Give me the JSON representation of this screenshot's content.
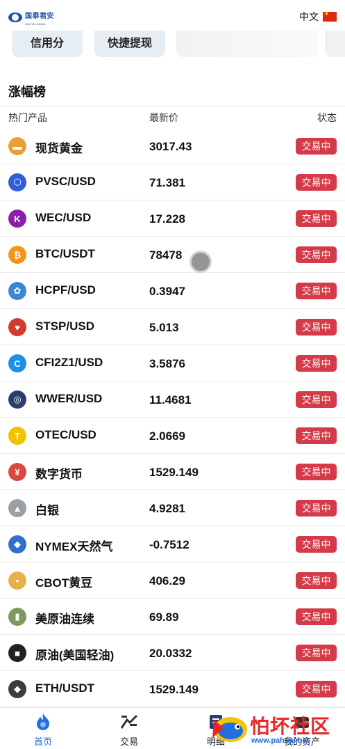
{
  "header": {
    "logo_text": "国泰君安",
    "logo_sub": "GUOTAI JUNAN",
    "language": "中文"
  },
  "cards": {
    "card1_label": "信用分",
    "card2_label": "快捷提现"
  },
  "section": {
    "title": "涨幅榜"
  },
  "columns": {
    "product": "热门产品",
    "price": "最新价",
    "status": "状态"
  },
  "rows": [
    {
      "name": "现货黄金",
      "price": "3017.43",
      "status": "交易中",
      "icon": "gold-ingot-icon",
      "color": "#e8a13a"
    },
    {
      "name": "PVSC/USD",
      "price": "71.381",
      "status": "交易中",
      "icon": "hexagon-icon",
      "color": "#2f5fd6"
    },
    {
      "name": "WEC/USD",
      "price": "17.228",
      "status": "交易中",
      "icon": "k-letter-icon",
      "color": "#8a1fa8"
    },
    {
      "name": "BTC/USDT",
      "price": "78478",
      "status": "交易中",
      "icon": "bitcoin-icon",
      "color": "#f7931a"
    },
    {
      "name": "HCPF/USD",
      "price": "0.3947",
      "status": "交易中",
      "icon": "flower-badge-icon",
      "color": "#3b87d6"
    },
    {
      "name": "STSP/USD",
      "price": "5.013",
      "status": "交易中",
      "icon": "heart-coin-icon",
      "color": "#d23b2c"
    },
    {
      "name": "CFI2Z1/USD",
      "price": "3.5876",
      "status": "交易中",
      "icon": "c-coin-icon",
      "color": "#1f8fe8"
    },
    {
      "name": "WWER/USD",
      "price": "11.4681",
      "status": "交易中",
      "icon": "ring-coin-icon",
      "color": "#2c3e6b"
    },
    {
      "name": "OTEC/USD",
      "price": "2.0669",
      "status": "交易中",
      "icon": "t-letter-icon",
      "color": "#f2c200"
    },
    {
      "name": "数字货币",
      "price": "1529.149",
      "status": "交易中",
      "icon": "yen-coin-icon",
      "color": "#d9473e"
    },
    {
      "name": "白银",
      "price": "4.9281",
      "status": "交易中",
      "icon": "silver-bars-icon",
      "color": "#9aa0a6"
    },
    {
      "name": "NYMEX天然气",
      "price": "-0.7512",
      "status": "交易中",
      "icon": "flame-icon",
      "color": "#2f6fc9"
    },
    {
      "name": "CBOT黄豆",
      "price": "406.29",
      "status": "交易中",
      "icon": "soybean-icon",
      "color": "#e8b04a"
    },
    {
      "name": "美原油连续",
      "price": "69.89",
      "status": "交易中",
      "icon": "oil-barrel-icon",
      "color": "#7d9a5c"
    },
    {
      "name": "原油(美国轻油)",
      "price": "20.0332",
      "status": "交易中",
      "icon": "oil-drum-icon",
      "color": "#222222"
    },
    {
      "name": "ETH/USDT",
      "price": "1529.149",
      "status": "交易中",
      "icon": "ethereum-icon",
      "color": "#3c3c3d"
    }
  ],
  "tabbar": {
    "home": "首页",
    "trade": "交易",
    "detail": "明细",
    "assets": "我的资产"
  },
  "watermark": {
    "text": "怕坏社区",
    "url": "www.pahuai.net"
  },
  "colors": {
    "status_bg": "#d43a47",
    "tab_active": "#1f6fe0"
  }
}
